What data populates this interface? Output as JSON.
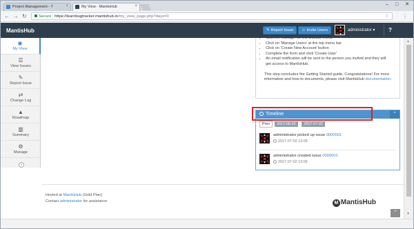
{
  "browser": {
    "tabs": [
      {
        "title": "Project Management - T",
        "active": false
      },
      {
        "title": "My View - MantisHub",
        "active": true
      }
    ],
    "secure_label": "Secure",
    "url_host": "https://learnbugtracker.mantishub.io",
    "url_path": "/my_view_page.php?days=0",
    "window_controls": "– □ ✕"
  },
  "navbar": {
    "brand": "MantisHub",
    "report_issue": "Report Issue",
    "invite_users": "Invite Users",
    "user": "administrator ▾",
    "help": "?"
  },
  "sidebar": {
    "items": [
      {
        "label": "My View",
        "icon": "dashboard-icon",
        "glyph": "◉",
        "active": true
      },
      {
        "label": "View Issues",
        "icon": "list-icon",
        "glyph": "☰",
        "active": false
      },
      {
        "label": "Report Issue",
        "icon": "edit-icon",
        "glyph": "✎",
        "active": false
      },
      {
        "label": "Change Log",
        "icon": "retweet-icon",
        "glyph": "⇄",
        "active": false
      },
      {
        "label": "Roadmap",
        "icon": "road-icon",
        "glyph": "▲",
        "active": false
      },
      {
        "label": "Summary",
        "icon": "bar-chart-icon",
        "glyph": "▥",
        "active": false
      },
      {
        "label": "Manage",
        "icon": "gears-icon",
        "glyph": "⚙",
        "active": false
      }
    ],
    "collapse_glyph": "«"
  },
  "guide": {
    "steps": [
      "Click on 'Manage' on the sidebar menu",
      "Click on 'Manage Users' at the top menu bar",
      "Click on 'Create New Account' button",
      "Complete the form and click 'Create User'",
      "An email notification will be sent to the person you invited and they will get access to MantisHub."
    ],
    "conclusion": "This step concludes the Getting Started guide. Congratulations! For more information and how-to documents, please visit MantisHub",
    "doc_link": "documentation",
    "period": "."
  },
  "timeline": {
    "title": "Timeline",
    "prev": "Prev",
    "date_from": "2017-06-25",
    "date_sep": "-",
    "date_to": "2017-07-02",
    "entries": [
      {
        "text": "administrator picked up issue",
        "issue": "0000001",
        "time": "2017-07-02 13:09"
      },
      {
        "text": "administrator created issue",
        "issue": "0000001",
        "time": "2017-07-02 13:09"
      }
    ]
  },
  "footer": {
    "hosted_prefix": "Hosted at",
    "hosted_link": "MantisHub",
    "hosted_plan": "(Gold Plan)",
    "contact_prefix": "Contact",
    "contact_link": "administrator",
    "contact_suffix": "for assistance",
    "logo_text": "MantisHub",
    "logo_glyph": "M"
  },
  "colors": {
    "navbar": "#2e3e4c",
    "accent": "#3a87c8",
    "timeline_header": "#4f93cf",
    "highlight": "#e0201c"
  }
}
